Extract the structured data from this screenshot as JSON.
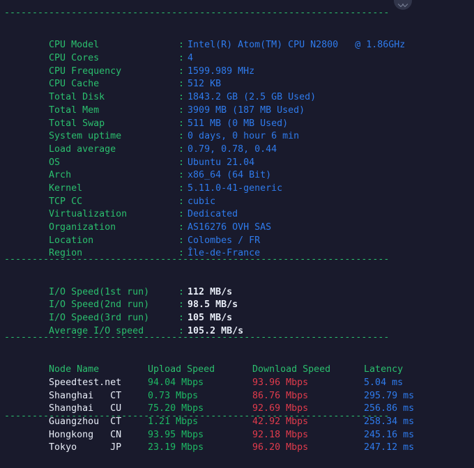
{
  "terminal": {
    "divider": "---------------------------------------------------------------------",
    "divider_bottom": "---------------------------------------------------------------------",
    "colon": ":"
  },
  "colors": {
    "background": "#191a2c",
    "label_green": "#2bbf6e",
    "value_blue": "#2f7bec",
    "value_white": "#e8edf7",
    "upload_green": "#1eb864",
    "download_red": "#e03b4c",
    "latency_blue": "#2f7bec"
  },
  "system_info": [
    {
      "label": "CPU Model",
      "value": "Intel(R) Atom(TM) CPU N2800   @ 1.86GHz"
    },
    {
      "label": "CPU Cores",
      "value": "4"
    },
    {
      "label": "CPU Frequency",
      "value": "1599.989 MHz"
    },
    {
      "label": "CPU Cache",
      "value": "512 KB"
    },
    {
      "label": "Total Disk",
      "value": "1843.2 GB (2.5 GB Used)"
    },
    {
      "label": "Total Mem",
      "value": "3909 MB (187 MB Used)"
    },
    {
      "label": "Total Swap",
      "value": "511 MB (0 MB Used)"
    },
    {
      "label": "System uptime",
      "value": "0 days, 0 hour 6 min"
    },
    {
      "label": "Load average",
      "value": "0.79, 0.78, 0.44"
    },
    {
      "label": "OS",
      "value": "Ubuntu 21.04"
    },
    {
      "label": "Arch",
      "value": "x86_64 (64 Bit)"
    },
    {
      "label": "Kernel",
      "value": "5.11.0-41-generic"
    },
    {
      "label": "TCP CC",
      "value": "cubic"
    },
    {
      "label": "Virtualization",
      "value": "Dedicated"
    },
    {
      "label": "Organization",
      "value": "AS16276 OVH SAS"
    },
    {
      "label": "Location",
      "value": "Colombes / FR"
    },
    {
      "label": "Region",
      "value": "Île-de-France"
    }
  ],
  "io_speed": [
    {
      "label": "I/O Speed(1st run)",
      "value": "112 MB/s"
    },
    {
      "label": "I/O Speed(2nd run)",
      "value": "98.5 MB/s"
    },
    {
      "label": "I/O Speed(3rd run)",
      "value": "105 MB/s"
    },
    {
      "label": "Average I/O speed",
      "value": "105.2 MB/s"
    }
  ],
  "speedtest": {
    "headers": {
      "node": "Node Name",
      "upload": "Upload Speed",
      "download": "Download Speed",
      "latency": "Latency"
    },
    "rows": [
      {
        "node": "Speedtest.net",
        "upload": "94.04 Mbps",
        "download": "93.96 Mbps",
        "latency": "5.04 ms"
      },
      {
        "node": "Shanghai   CT",
        "upload": "0.73 Mbps",
        "download": "86.76 Mbps",
        "latency": "295.79 ms"
      },
      {
        "node": "Shanghai   CU",
        "upload": "75.20 Mbps",
        "download": "92.69 Mbps",
        "latency": "256.86 ms"
      },
      {
        "node": "Guangzhou  CT",
        "upload": "1.21 Mbps",
        "download": "42.92 Mbps",
        "latency": "258.34 ms"
      },
      {
        "node": "Hongkong   CN",
        "upload": "93.95 Mbps",
        "download": "92.18 Mbps",
        "latency": "245.16 ms"
      },
      {
        "node": "Tokyo      JP",
        "upload": "23.19 Mbps",
        "download": "96.20 Mbps",
        "latency": "247.12 ms"
      }
    ]
  }
}
